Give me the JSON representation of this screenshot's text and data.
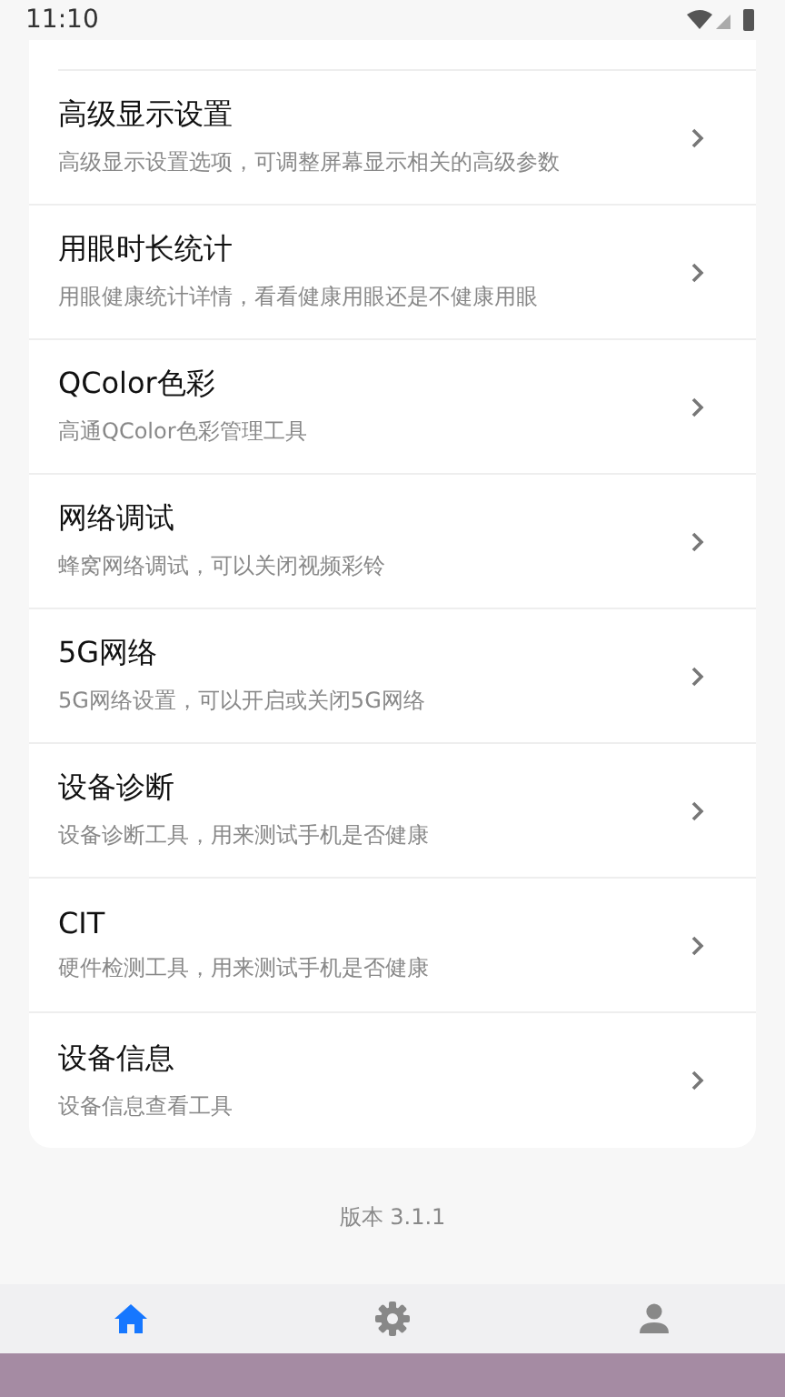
{
  "status_bar": {
    "time": "11:10"
  },
  "items": [
    {
      "title": "高级显示设置",
      "subtitle": "高级显示设置选项，可调整屏幕显示相关的高级参数"
    },
    {
      "title": "用眼时长统计",
      "subtitle": "用眼健康统计详情，看看健康用眼还是不健康用眼"
    },
    {
      "title": "QColor色彩",
      "subtitle": "高通QColor色彩管理工具"
    },
    {
      "title": "网络调试",
      "subtitle": "蜂窝网络调试，可以关闭视频彩铃"
    },
    {
      "title": "5G网络",
      "subtitle": "5G网络设置，可以开启或关闭5G网络"
    },
    {
      "title": "设备诊断",
      "subtitle": "设备诊断工具，用来测试手机是否健康"
    },
    {
      "title": "CIT",
      "subtitle": "硬件检测工具，用来测试手机是否健康"
    },
    {
      "title": "设备信息",
      "subtitle": "设备信息查看工具"
    }
  ],
  "version": "版本 3.1.1",
  "bottom_nav": [
    {
      "kind": "home",
      "selected": true
    },
    {
      "kind": "settings",
      "selected": false
    },
    {
      "kind": "profile",
      "selected": false
    }
  ]
}
